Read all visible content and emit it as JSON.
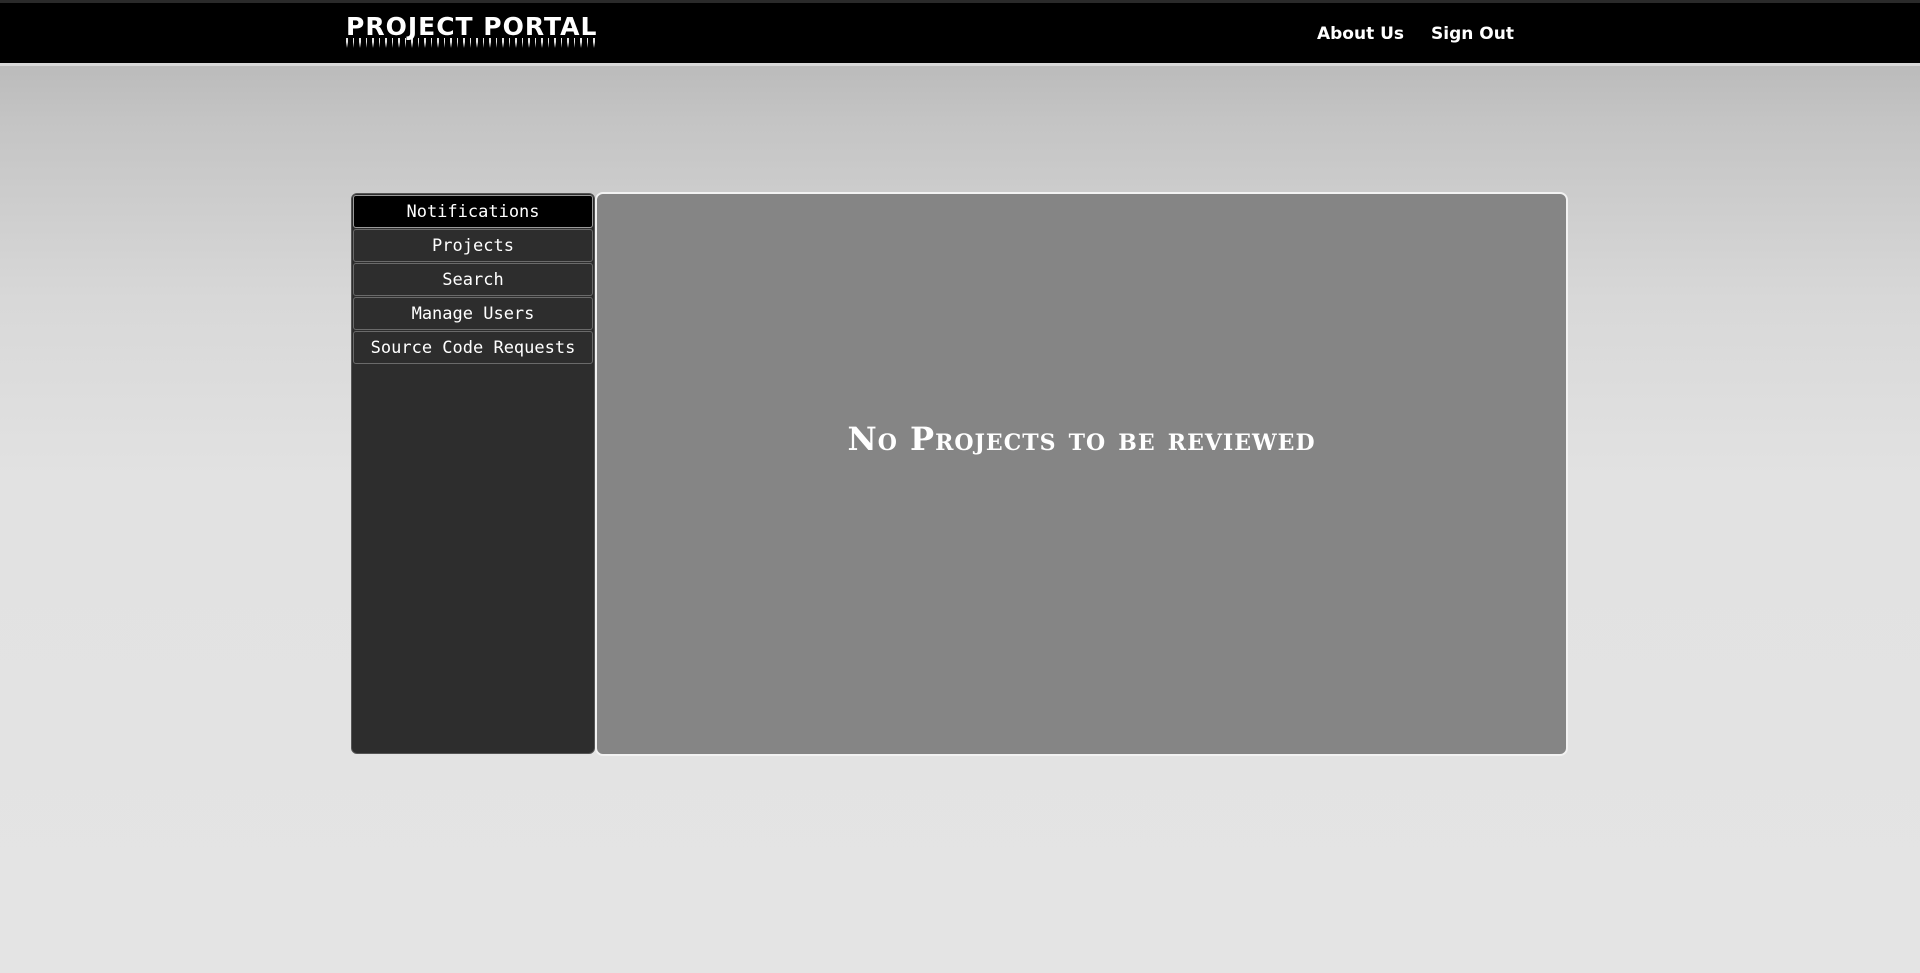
{
  "header": {
    "logo_text": "PROJECT PORTAL",
    "nav": [
      {
        "label": "About Us"
      },
      {
        "label": "Sign Out"
      }
    ]
  },
  "sidebar": {
    "items": [
      {
        "label": "Notifications",
        "active": true
      },
      {
        "label": "Projects",
        "active": false
      },
      {
        "label": "Search",
        "active": false
      },
      {
        "label": "Manage Users",
        "active": false
      },
      {
        "label": "Source Code Requests",
        "active": false
      }
    ]
  },
  "main": {
    "message": "No Projects to be reviewed"
  }
}
